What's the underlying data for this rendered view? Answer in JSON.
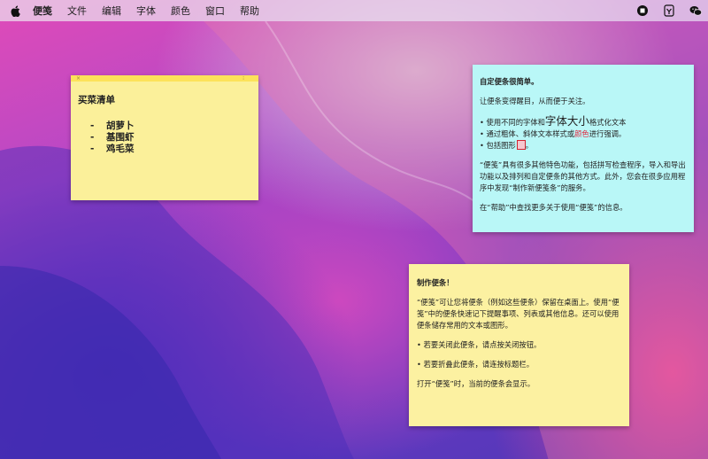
{
  "menubar": {
    "app_name": "便笺",
    "items": [
      "文件",
      "编辑",
      "字体",
      "颜色",
      "窗口",
      "帮助"
    ],
    "status_icons": [
      "stop-record-icon",
      "input-method-icon",
      "wechat-icon"
    ]
  },
  "note_shopping": {
    "title": "买菜清单",
    "items": [
      "胡萝卜",
      "基围虾",
      "鸡毛菜"
    ],
    "bullet": "-",
    "color": "#fbf09a"
  },
  "note_customize": {
    "title": "自定便条很简单。",
    "line1": "让便条变得醒目，从而便于关注。",
    "b1_pre": "• 使用不同的字体和",
    "b1_big": "字体大小",
    "b1_post": "格式化文本",
    "b2_pre": "• 通过粗体、斜体文本样式或",
    "b2_red": "颜色",
    "b2_post": "进行强调。",
    "b3": "• 包括图形",
    "b3_end": "。",
    "para": "“便笺”具有很多其他特色功能，包括拼写检查程序，导入和导出功能以及排列和自定便条的其他方式。此外，您会在很多应用程序中发现“制作新便笺条”的服务。",
    "help": "在“帮助”中查找更多关于使用“便笺”的信息。",
    "color": "#b9f7f7",
    "accent_red": "#e0253c"
  },
  "note_make": {
    "title": "制作便条！",
    "para": "“便笺”可让您将便条（例如这些便条）保留在桌面上。使用“便笺”中的便条快速记下提醒事项、列表或其他信息。还可以使用便条储存常用的文本或图形。",
    "b1": "• 若要关闭此便条，请点按关闭按钮。",
    "b2": "• 若要折叠此便条，请连按标题栏。",
    "footer": "打开“便笺”时，当前的便条会显示。",
    "color": "#fcf1a1"
  }
}
